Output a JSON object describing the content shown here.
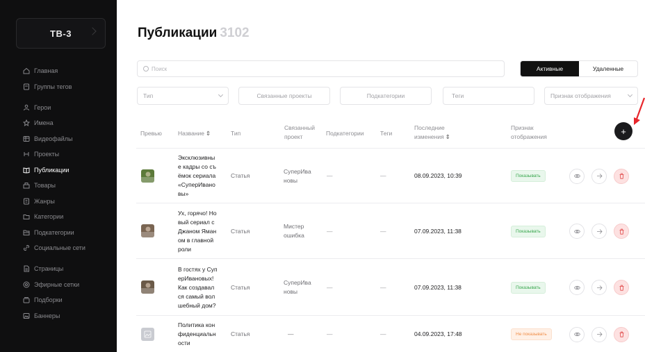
{
  "sidebar": {
    "logo": "ТВ-3",
    "groups": [
      [
        {
          "label": "Главная",
          "icon": "home-icon"
        },
        {
          "label": "Группы тегов",
          "icon": "tag-group-icon"
        }
      ],
      [
        {
          "label": "Герои",
          "icon": "heroes-icon"
        },
        {
          "label": "Имена",
          "icon": "star-icon"
        },
        {
          "label": "Видеофайлы",
          "icon": "video-file-icon"
        },
        {
          "label": "Проекты",
          "icon": "projects-icon"
        },
        {
          "label": "Публикации",
          "icon": "book-icon",
          "active": true
        },
        {
          "label": "Товары",
          "icon": "goods-icon"
        },
        {
          "label": "Жанры",
          "icon": "genres-icon"
        },
        {
          "label": "Категории",
          "icon": "folder-icon"
        },
        {
          "label": "Подкатегории",
          "icon": "subfolder-icon"
        },
        {
          "label": "Социальные сети",
          "icon": "link-icon"
        }
      ],
      [
        {
          "label": "Страницы",
          "icon": "page-icon"
        },
        {
          "label": "Эфирные сетки",
          "icon": "broadcast-icon"
        },
        {
          "label": "Подборки",
          "icon": "collection-icon"
        },
        {
          "label": "Баннеры",
          "icon": "banner-icon"
        }
      ]
    ]
  },
  "header": {
    "title": "Публикации",
    "count": "3102"
  },
  "search": {
    "placeholder": "Поиск"
  },
  "tabs": {
    "active": "Активные",
    "deleted": "Удаленные"
  },
  "filters": {
    "type": "Тип",
    "projects": "Связанные проекты",
    "subcategories": "Подкатегории",
    "tags": "Теги",
    "display": "Признак отображения"
  },
  "table": {
    "headers": {
      "preview": "Превью",
      "name": "Название",
      "name_sort": "⇕",
      "type": "Тип",
      "project_l1": "Связанный",
      "project_l2": "проект",
      "subcategories": "Подкатегории",
      "tags": "Теги",
      "changed_l1": "Последние",
      "changed_l2": "изменения",
      "changed_sort": "⇕",
      "display_l1": "Признак",
      "display_l2": "отображения"
    },
    "add_label": "+",
    "rows": [
      {
        "name": [
          "Эксклюзивны",
          "е кадры со съ",
          "ёмок сериала",
          "«СуперИвано",
          "вы»"
        ],
        "type": "Статья",
        "project": [
          "СуперИва",
          "новы"
        ],
        "subcategories": "—",
        "tags": "—",
        "changed": "08.09.2023, 10:39",
        "display": "Показывать",
        "display_state": "show",
        "thumb_color": "#5c7a3a"
      },
      {
        "name": [
          "Ух, горячо! Но",
          "вый сериал с",
          "Джаном Яман",
          "ом в главной",
          "роли"
        ],
        "type": "Статья",
        "project": [
          "Мистер",
          "ошибка"
        ],
        "subcategories": "—",
        "tags": "—",
        "changed": "07.09.2023, 11:38",
        "display": "Показывать",
        "display_state": "show",
        "thumb_color": "#7a6552"
      },
      {
        "name": [
          "В гостях у Суп",
          "ерИвановых!",
          "Как создавал",
          "ся самый вол",
          "шебный дом?"
        ],
        "type": "Статья",
        "project": [
          "СуперИва",
          "новы"
        ],
        "subcategories": "—",
        "tags": "—",
        "changed": "07.09.2023, 11:38",
        "display": "Показывать",
        "display_state": "show",
        "thumb_color": "#6b5a48"
      },
      {
        "name": [
          "Политика кон",
          "фиденциальн",
          "ости"
        ],
        "type": "Статья",
        "project": [
          "—"
        ],
        "subcategories": "—",
        "tags": "—",
        "changed": "04.09.2023, 17:48",
        "display": "Не показывать",
        "display_state": "hide",
        "thumb_color": "#c9cbd1"
      }
    ]
  },
  "colors": {
    "sidebar_bg": "#0f0f10",
    "accent_dark": "#111111",
    "show_green": "#37a64c",
    "hide_orange": "#f08d47",
    "delete_red": "#e04848",
    "annotation_red": "#e8262c"
  }
}
